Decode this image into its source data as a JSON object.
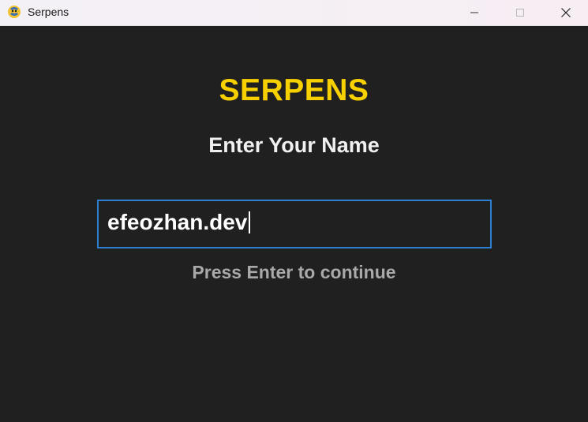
{
  "window": {
    "title": "Serpens",
    "app_icon": "python-snake-icon",
    "controls": {
      "minimize_icon": "minimize-icon",
      "maximize_icon": "maximize-icon",
      "close_icon": "close-icon"
    }
  },
  "screen": {
    "game_title": "SERPENS",
    "prompt": "Enter Your Name",
    "input_value": "efeozhan.dev",
    "hint": "Press Enter to continue"
  },
  "colors": {
    "background": "#202020",
    "title_yellow": "#f7d000",
    "input_border": "#2d7fd3",
    "hint_gray": "#a9a9a9"
  }
}
